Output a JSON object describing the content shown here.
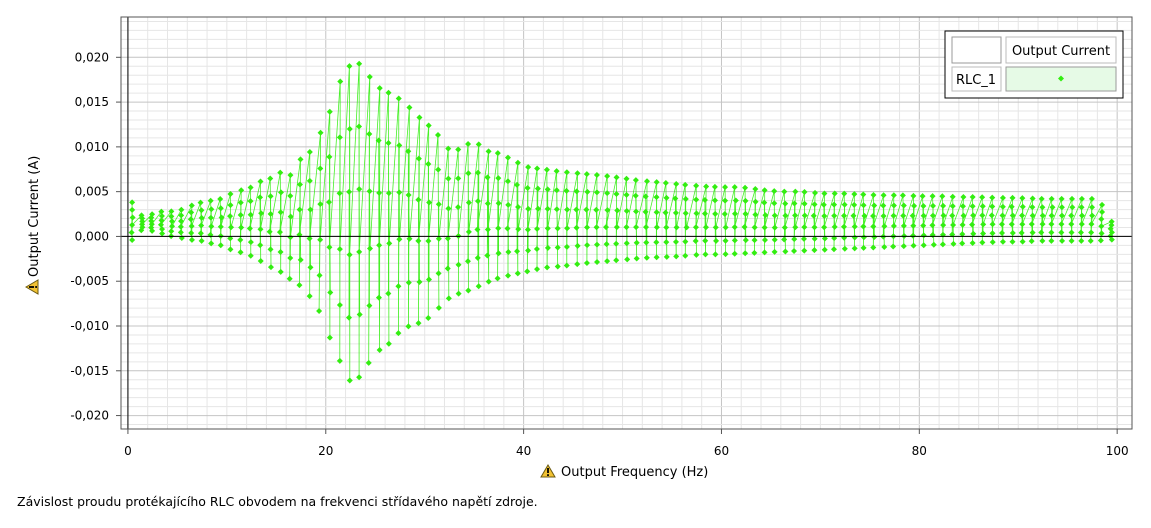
{
  "chart_data": {
    "type": "scatter",
    "xlabel": "Output Frequency (Hz)",
    "ylabel": "Output Current (A)",
    "xlim": [
      -0.7,
      101.5
    ],
    "ylim": [
      -0.0215,
      0.0245
    ],
    "x_ticks": [
      0,
      20,
      40,
      60,
      80,
      100
    ],
    "y_ticks": [
      -0.02,
      -0.015,
      -0.01,
      -0.005,
      0.0,
      0.005,
      0.01,
      0.015,
      0.02
    ],
    "x_tick_labels": [
      "0",
      "20",
      "40",
      "60",
      "80",
      "100"
    ],
    "y_tick_labels": [
      "-0,020",
      "-0,015",
      "-0,010",
      "-0,005",
      "0,000",
      "0,005",
      "0,010",
      "0,015",
      "0,020"
    ],
    "grid": true,
    "legend_position": "top-right",
    "legend_header": "Output Current",
    "series": [
      {
        "name": "RLC_1",
        "color": "#33ee11",
        "marker": "diamond",
        "envelope": {
          "x": [
            0.4,
            1.5,
            2.5,
            3.5,
            4.5,
            5.5,
            6.5,
            7.5,
            8.5,
            9.5,
            10.5,
            11.5,
            12.5,
            13.5,
            14.5,
            15.5,
            16.5,
            17.5,
            18.5,
            19.5,
            20.0,
            21.0,
            22.0,
            23.0,
            24.0,
            25.0,
            26.0,
            27.0,
            28.0,
            29.0,
            30.0,
            31.0,
            32.0,
            33.0,
            34.0,
            35.0,
            36.0,
            37.0,
            38.0,
            39.0,
            40.0,
            42.0,
            44.0,
            46.0,
            48.0,
            50.0,
            52.0,
            54.0,
            56.0,
            58.0,
            60.0,
            62.0,
            64.0,
            66.0,
            68.0,
            70.0,
            72.0,
            74.0,
            76.0,
            78.0,
            80.0,
            82.0,
            84.0,
            86.0,
            88.0,
            90.0,
            92.0,
            94.0,
            96.0,
            98.0,
            99.0,
            100.0
          ],
          "upper": [
            0.0038,
            0.0022,
            0.0025,
            0.0028,
            0.0028,
            0.003,
            0.0035,
            0.0038,
            0.004,
            0.0042,
            0.0048,
            0.0052,
            0.0055,
            0.0062,
            0.0065,
            0.0072,
            0.0068,
            0.0088,
            0.0095,
            0.0118,
            0.0122,
            0.0165,
            0.0185,
            0.0198,
            0.0185,
            0.0168,
            0.0162,
            0.0158,
            0.0148,
            0.0138,
            0.0125,
            0.0122,
            0.01,
            0.0095,
            0.01,
            0.0108,
            0.0095,
            0.0095,
            0.009,
            0.0085,
            0.0078,
            0.0075,
            0.0072,
            0.007,
            0.0068,
            0.0065,
            0.0062,
            0.006,
            0.0058,
            0.0056,
            0.0055,
            0.0055,
            0.0052,
            0.005,
            0.005,
            0.0048,
            0.0048,
            0.0047,
            0.0046,
            0.0046,
            0.0045,
            0.0045,
            0.0044,
            0.0044,
            0.0043,
            0.0043,
            0.0042,
            0.0042,
            0.0042,
            0.0042,
            0.0025,
            0.0004
          ],
          "lower": [
            -0.0004,
            0.0008,
            0.0006,
            0.0003,
            0.0,
            -0.0002,
            -0.0004,
            -0.0005,
            -0.0008,
            -0.001,
            -0.0015,
            -0.0018,
            -0.0022,
            -0.0028,
            -0.0035,
            -0.004,
            -0.0048,
            -0.0055,
            -0.0068,
            -0.0085,
            -0.0105,
            -0.0125,
            -0.016,
            -0.0162,
            -0.015,
            -0.0128,
            -0.0125,
            -0.0112,
            -0.0102,
            -0.0098,
            -0.0095,
            -0.0085,
            -0.0072,
            -0.0065,
            -0.0062,
            -0.0058,
            -0.0052,
            -0.0048,
            -0.0045,
            -0.0042,
            -0.004,
            -0.0035,
            -0.0033,
            -0.003,
            -0.0028,
            -0.0026,
            -0.0024,
            -0.0023,
            -0.0022,
            -0.002,
            -0.002,
            -0.0019,
            -0.0018,
            -0.0017,
            -0.0016,
            -0.0015,
            -0.0014,
            -0.0013,
            -0.0012,
            -0.0011,
            -0.001,
            -0.0009,
            -0.0008,
            -0.0007,
            -0.0006,
            -0.0006,
            -0.0005,
            -0.0005,
            -0.0005,
            -0.0005,
            -0.0004,
            -0.0003
          ]
        }
      }
    ]
  },
  "caption": "Závislost proudu protékajícího RLC obvodem na frekvenci střídavého napětí zdroje.",
  "warning_icon_name": "warning-icon"
}
